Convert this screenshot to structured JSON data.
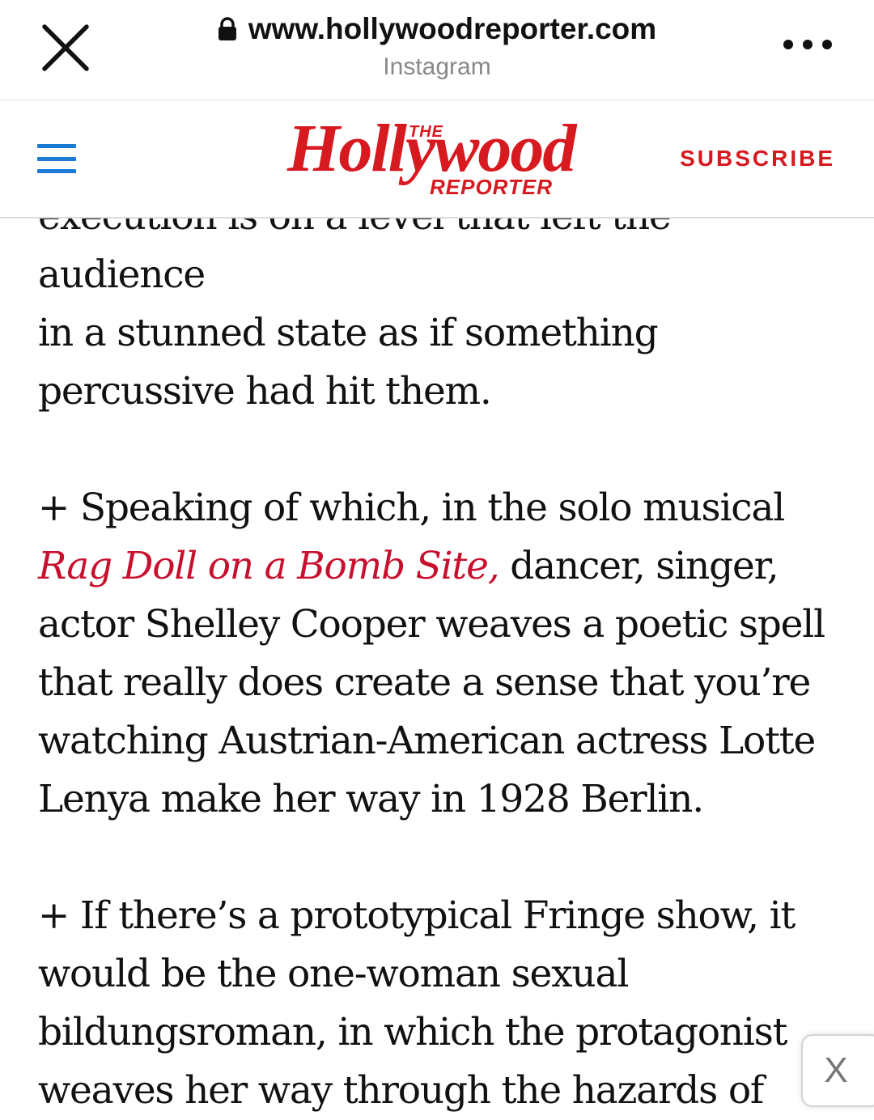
{
  "browser": {
    "url": "www.hollywoodreporter.com",
    "app": "Instagram",
    "close_icon": "close-icon",
    "lock_icon": "lock-icon",
    "more_icon": "more-icon"
  },
  "header": {
    "menu_icon": "hamburger-icon",
    "logo": {
      "the": "THE",
      "main": "Hollywood",
      "reporter": "REPORTER"
    },
    "subscribe": "SUBSCRIBE",
    "colors": {
      "brand": "#d71920",
      "menu": "#1a7ad4"
    }
  },
  "article": {
    "p1": {
      "line_partial": "execution is on a level that left the audience",
      "text": "in a stunned state as if something percussive had hit them."
    },
    "p2": {
      "before": "+ Speaking of which, in the solo musical ",
      "link": "Rag Doll on a Bomb Site,",
      "after": " dancer, singer, actor Shelley Cooper weaves a poetic spell that really does create a sense that you’re watching Austrian-American actress Lotte Lenya make her way in 1928 Berlin."
    },
    "p3": {
      "text": "+ If there’s a prototypical Fringe show, it would be the one-woman sexual bildungsroman, in which the protagonist weaves her way through the hazards of"
    },
    "link_color": "#c8102e"
  },
  "ad_close": {
    "label": "X"
  }
}
